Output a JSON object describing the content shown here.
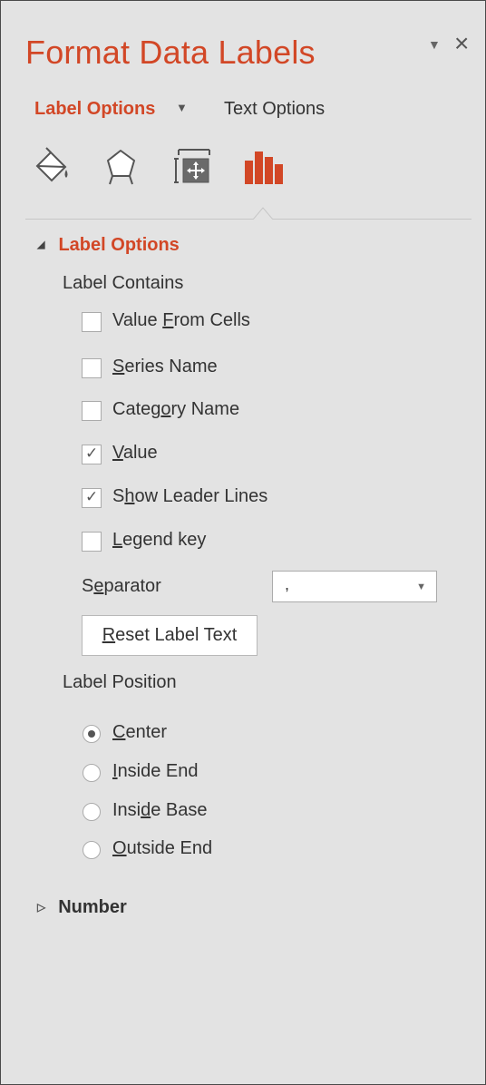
{
  "pane": {
    "title": "Format Data Labels",
    "menu_glyph": "▼",
    "close_glyph": "×"
  },
  "tabs": {
    "label_options": "Label Options",
    "label_options_arrow": "▼",
    "text_options": "Text Options"
  },
  "icons": [
    "fill-line-icon",
    "effects-icon",
    "size-properties-icon",
    "label-options-icon"
  ],
  "section": {
    "title": "Label Options",
    "label_contains": "Label Contains",
    "checkboxes": [
      {
        "pre": "Value ",
        "u": "F",
        "post": "rom Cells",
        "checked": false
      },
      {
        "pre": "",
        "u": "S",
        "post": "eries Name",
        "checked": false
      },
      {
        "pre": "Categ",
        "u": "o",
        "post": "ry Name",
        "checked": false
      },
      {
        "pre": "",
        "u": "V",
        "post": "alue",
        "checked": true
      },
      {
        "pre": "S",
        "u": "h",
        "post": "ow Leader Lines",
        "checked": true
      },
      {
        "pre": "",
        "u": "L",
        "post": "egend key",
        "checked": false
      }
    ],
    "separator_pre": "S",
    "separator_u": "e",
    "separator_post": "parator",
    "separator_value": ",",
    "reset_pre": "",
    "reset_u": "R",
    "reset_post": "eset Label Text",
    "label_position": "Label Position",
    "radios": [
      {
        "pre": "",
        "u": "C",
        "post": "enter",
        "selected": true
      },
      {
        "pre": "",
        "u": "I",
        "post": "nside End",
        "selected": false
      },
      {
        "pre": "Insi",
        "u": "d",
        "post": "e Base",
        "selected": false
      },
      {
        "pre": "",
        "u": "O",
        "post": "utside End",
        "selected": false
      }
    ]
  },
  "number_section": {
    "title": "Number"
  },
  "colors": {
    "accent": "#d24726",
    "background": "#e3e3e3"
  }
}
